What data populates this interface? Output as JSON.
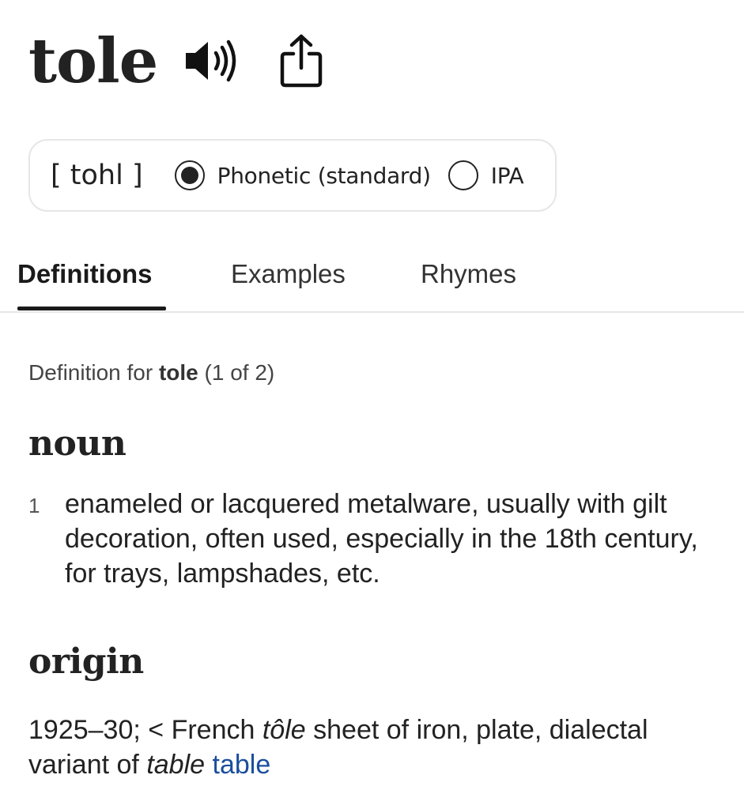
{
  "entry": {
    "headword": "tole"
  },
  "icons": {
    "speaker": "speaker-icon",
    "share": "share-icon"
  },
  "pronunciation": {
    "text": "[ tohl ]",
    "options": [
      {
        "label": "Phonetic (standard)",
        "selected": true
      },
      {
        "label": "IPA",
        "selected": false
      }
    ]
  },
  "tabs": [
    {
      "label": "Definitions",
      "active": true
    },
    {
      "label": "Examples",
      "active": false
    },
    {
      "label": "Rhymes",
      "active": false
    }
  ],
  "definition_header": {
    "prefix": "Definition for",
    "word": "tole",
    "count": "(1 of 2)"
  },
  "noun": {
    "heading": "noun",
    "definitions": [
      {
        "number": "1",
        "text": "enameled or lacquered metalware, usually with gilt decoration, often used, especially in the 18th century, for trays, lampshades, etc."
      }
    ]
  },
  "origin": {
    "heading": "origin",
    "date": "1925–30;",
    "lt": "<",
    "language": "French",
    "etymon": "tôle",
    "gloss": "sheet of iron, plate, dialectal variant of",
    "variant": "table",
    "link": "table"
  },
  "colors": {
    "text": "#1a1a1a",
    "link": "#1a4e9c",
    "border": "#e6e6e6"
  }
}
